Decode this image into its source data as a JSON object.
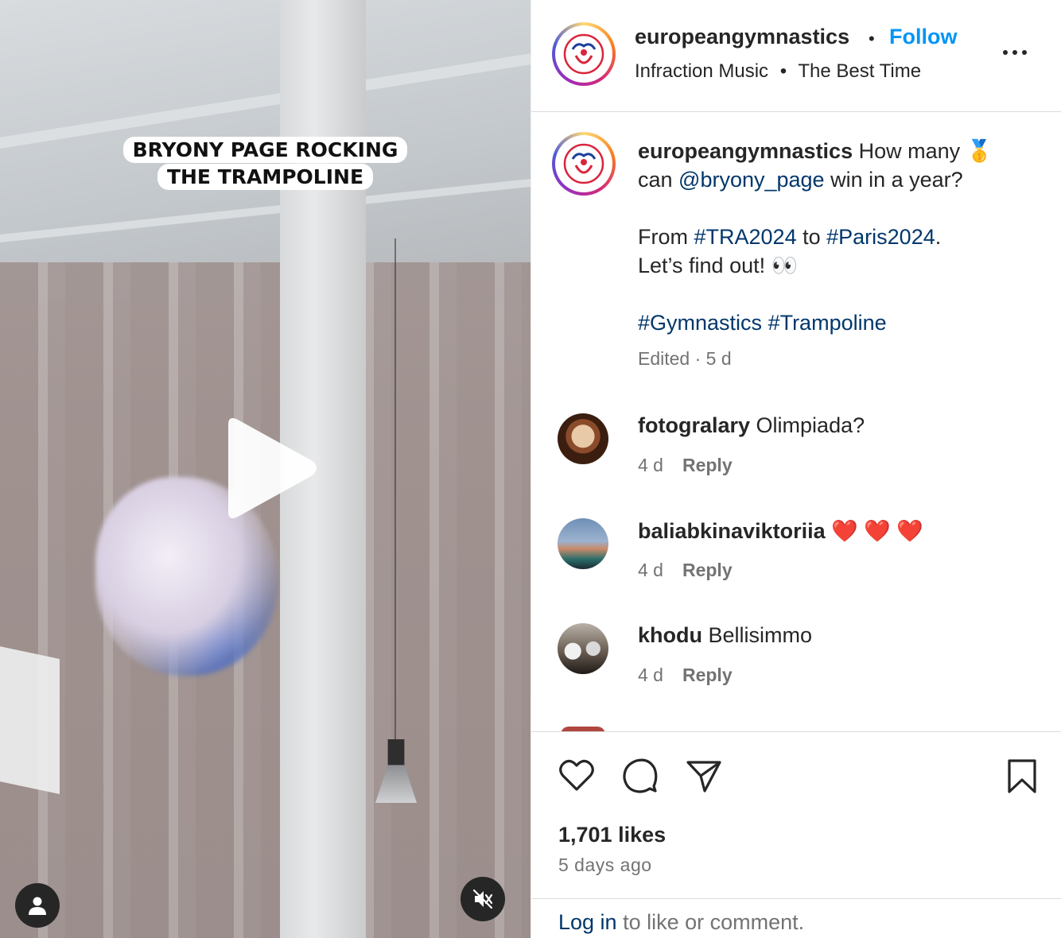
{
  "media": {
    "sticker_line1": "BRYONY PAGE ROCKING",
    "sticker_line2": "THE TRAMPOLINE",
    "play_icon": "play-icon",
    "user_icon": "user-icon",
    "mute_icon": "volume-muted-icon"
  },
  "header": {
    "username": "europeangymnastics",
    "separator": "•",
    "follow_label": "Follow",
    "audio_artist": "Infraction Music",
    "audio_separator": "•",
    "audio_track": "The Best Time",
    "more_icon": "more-icon"
  },
  "caption": {
    "username": "europeangymnastics",
    "text_1": "How many ",
    "emoji_medal": "🥇",
    "text_2": "can ",
    "mention": "@bryony_page",
    "text_3": " win in a year?",
    "text_4": "From ",
    "hashtag_1": "#TRA2024",
    "text_5": " to ",
    "hashtag_2": "#Paris2024",
    "text_6": ".",
    "text_7": "Let’s find out! ",
    "emoji_eyes": "👀",
    "hashtag_3": "#Gymnastics",
    "hashtag_4": "#Trampoline",
    "meta": "Edited · 5 d"
  },
  "comments": [
    {
      "username": "fotogralary",
      "text": "Olimpiada?",
      "time": "4 d",
      "reply_label": "Reply"
    },
    {
      "username": "baliabkinaviktoriia",
      "text": "❤️ ❤️ ❤️",
      "time": "4 d",
      "reply_label": "Reply"
    },
    {
      "username": "khodu",
      "text": "Bellisimmo",
      "time": "4 d",
      "reply_label": "Reply"
    }
  ],
  "actions": {
    "like_icon": "heart-icon",
    "comment_icon": "comment-icon",
    "share_icon": "share-icon",
    "save_icon": "bookmark-icon",
    "likes": "1,701 likes",
    "posted": "5 days ago"
  },
  "footer": {
    "login_link": "Log in",
    "login_text": " to like or comment."
  },
  "colors": {
    "follow": "#0095f6",
    "link": "#00376b",
    "secondary_text": "#737373"
  }
}
